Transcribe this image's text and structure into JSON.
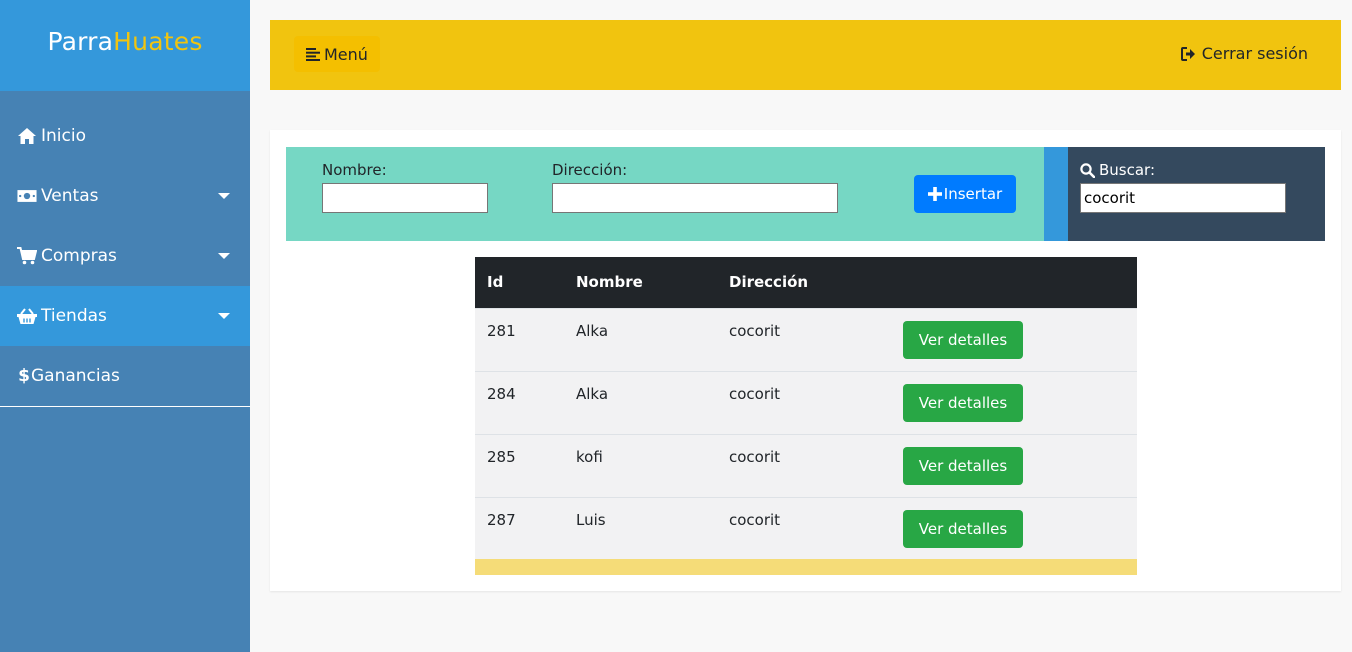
{
  "brand": {
    "part1": "Parra",
    "part2": "Huates"
  },
  "sidebar": {
    "items": [
      {
        "label": "Inicio",
        "icon": "home-icon"
      },
      {
        "label": "Ventas",
        "icon": "money-icon"
      },
      {
        "label": "Compras",
        "icon": "cart-icon"
      },
      {
        "label": "Tiendas",
        "icon": "basket-icon"
      },
      {
        "label": "Ganancias",
        "icon": "dollar-icon"
      }
    ]
  },
  "topbar": {
    "menu_label": "Menú",
    "logout_label": "Cerrar sesión"
  },
  "form": {
    "nombre_label": "Nombre:",
    "nombre_value": "",
    "direccion_label": "Dirección:",
    "direccion_value": "",
    "insert_label": "Insertar"
  },
  "search": {
    "label": "Buscar:",
    "value": "cocorit"
  },
  "table": {
    "headers": [
      "Id",
      "Nombre",
      "Dirección",
      ""
    ],
    "rows": [
      {
        "id": "281",
        "nombre": "Alka",
        "direccion": "cocorit",
        "action": "Ver detalles"
      },
      {
        "id": "284",
        "nombre": "Alka",
        "direccion": "cocorit",
        "action": "Ver detalles"
      },
      {
        "id": "285",
        "nombre": "kofi",
        "direccion": "cocorit",
        "action": "Ver detalles"
      },
      {
        "id": "287",
        "nombre": "Luis",
        "direccion": "cocorit",
        "action": "Ver detalles"
      }
    ]
  },
  "colors": {
    "sidebar": "#4682b4",
    "brand_bg": "#3498db",
    "topbar": "#f1c40f",
    "formbar": "#76d7c4",
    "searchbox": "#34495e",
    "primary": "#007bff",
    "success": "#28a745"
  }
}
